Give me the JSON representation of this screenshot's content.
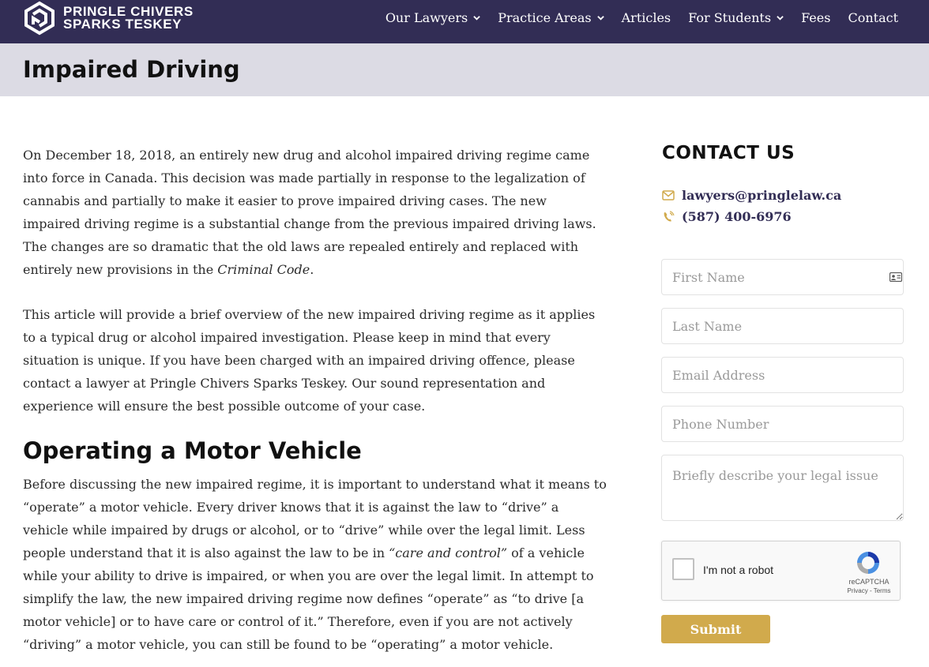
{
  "header": {
    "brand_line1": "PRINGLE CHIVERS",
    "brand_line2": "SPARKS TESKEY",
    "nav": [
      {
        "label": "Our Lawyers",
        "dropdown": true
      },
      {
        "label": "Practice Areas",
        "dropdown": true
      },
      {
        "label": "Articles",
        "dropdown": false
      },
      {
        "label": "For Students",
        "dropdown": true
      },
      {
        "label": "Fees",
        "dropdown": false
      },
      {
        "label": "Contact",
        "dropdown": false
      }
    ],
    "icons": {
      "logo": "firm-logo-icon",
      "dropdown": "chevron-down-icon"
    }
  },
  "page": {
    "title": "Impaired Driving"
  },
  "article": {
    "p1_text": "On December 18, 2018, an entirely new drug and alcohol impaired driving regime came into force in Canada. This decision was made partially in response to the legalization of cannabis and partially to make it easier to prove impaired driving cases. The new impaired driving regime is a substantial change from the previous impaired driving laws. The changes are so dramatic that the old laws are repealed entirely and replaced with entirely new provisions in the ",
    "p1_em": "Criminal Code",
    "p1_end": ".",
    "p2": "This article will provide a brief overview of the new impaired driving regime as it applies to a typical drug or alcohol impaired investigation. Please keep in mind that every situation is unique. If you have been charged with an impaired driving offence, please contact a lawyer at Pringle Chivers Sparks Teskey. Our sound representation and experience will ensure the best possible outcome of your case.",
    "h2": "Operating a Motor Vehicle",
    "p3_a": "Before discussing the new impaired regime, it is important to understand what it means to “operate” a motor vehicle. Every driver knows that it is against the law to “drive” a vehicle while impaired by drugs or alcohol, or to “drive” while over the legal limit. Less people understand that it is also against the law to be in ",
    "p3_em": "“care and control”",
    "p3_b": " of a vehicle while your ability to drive is impaired, or when you are over the legal limit. In attempt to simplify the law, the new impaired driving regime now defines “operate” as “to drive [a motor vehicle] or to have care or control of it.” Therefore, even if you are not actively “driving” a motor vehicle, you can still be found to be “operating” a motor vehicle."
  },
  "contact": {
    "title": "CONTACT US",
    "email": "lawyers@pringlelaw.ca",
    "phone": "(587) 400-6976",
    "icons": {
      "email": "envelope-icon",
      "phone": "phone-icon",
      "autofill": "contact-card-icon"
    },
    "form": {
      "first_name_placeholder": "First Name",
      "last_name_placeholder": "Last Name",
      "email_placeholder": "Email Address",
      "phone_placeholder": "Phone Number",
      "issue_placeholder": "Briefly describe your legal issue",
      "recaptcha_label": "I'm not a robot",
      "recaptcha_brand": "reCAPTCHA",
      "recaptcha_links": "Privacy - Terms",
      "submit_label": "Submit"
    }
  },
  "colors": {
    "header_bg": "#322d55",
    "title_band": "#dcdbe4",
    "accent_gold": "#d1aa4c",
    "link_navy": "#322d55"
  }
}
